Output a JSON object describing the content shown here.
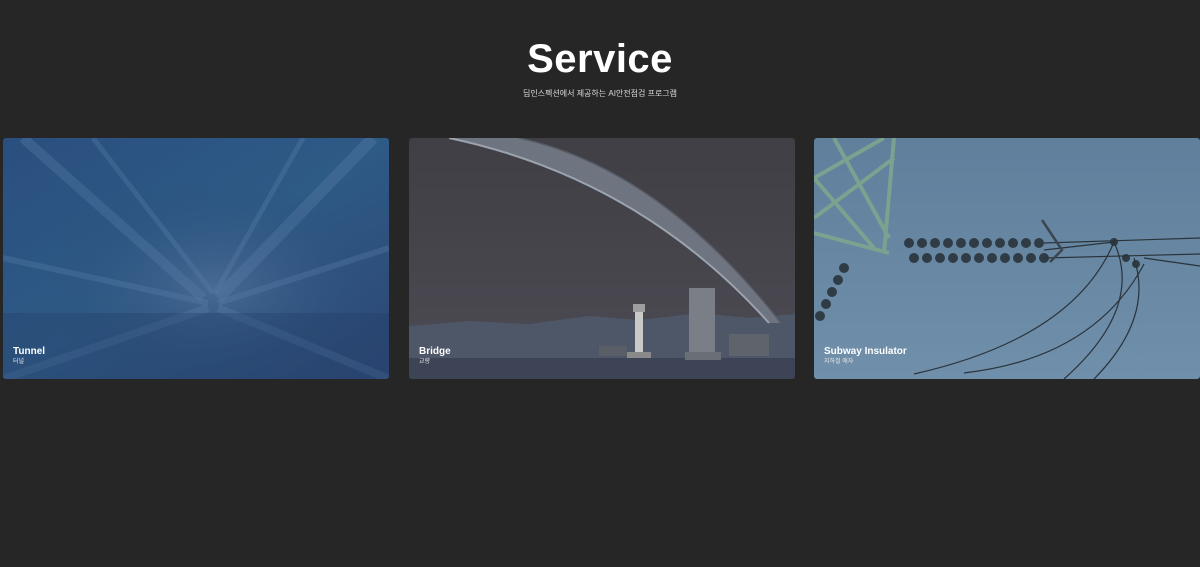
{
  "section": {
    "title": "Service",
    "subtitle": "딥인스펙션에서 제공하는 AI안전점검 프로그램"
  },
  "cards": [
    {
      "name": "Tunnel",
      "sub": "터널",
      "image": "tunnel-photo"
    },
    {
      "name": "Bridge",
      "sub": "교량",
      "image": "bridge-photo"
    },
    {
      "name": "Subway Insulator",
      "sub": "지하철 애자",
      "image": "insulator-photo"
    }
  ],
  "colors": {
    "background": "#262626",
    "tunnel_tint": "#2c4d78",
    "bridge_tint": "#45454a",
    "insulator_tint": "#6a8aa6"
  }
}
